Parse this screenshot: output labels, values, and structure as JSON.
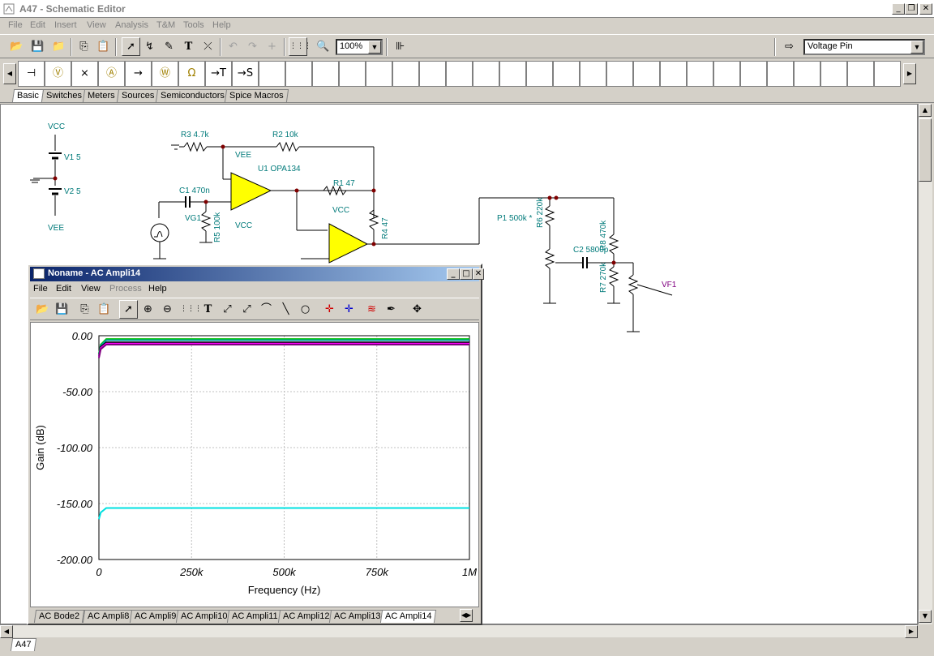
{
  "window": {
    "title": "A47 - Schematic Editor"
  },
  "menu": [
    "File",
    "Edit",
    "Insert",
    "View",
    "Analysis",
    "T&M",
    "Tools",
    "Help"
  ],
  "toolbar": {
    "zoom": "100%",
    "pin_type": "Voltage Pin"
  },
  "component_tabs": [
    "Basic",
    "Switches",
    "Meters",
    "Sources",
    "Semiconductors",
    "Spice Macros"
  ],
  "schematic": {
    "labels": {
      "vcc1": "VCC",
      "v1": "V1 5",
      "v2": "V2 5",
      "vee1": "VEE",
      "r3": "R3 4.7k",
      "r2": "R2 10k",
      "vee2": "VEE",
      "u1": "U1 OPA134",
      "c1": "C1 470n",
      "r1": "R1 47",
      "vg1": "VG1",
      "r5": "R5 100k",
      "vcc2": "VCC",
      "vcc3": "VCC",
      "r4": "R4 47",
      "p1": "P1 500k *",
      "r6": "R6 220k",
      "c2": "C2 5800p",
      "r8": "R8 470k",
      "r7": "R7 270k",
      "vf1": "VF1"
    }
  },
  "bottom_tab": "A47",
  "analysis_window": {
    "title": "Noname - AC Ampli14",
    "menu": [
      "File",
      "Edit",
      "View",
      "Process",
      "Help"
    ],
    "tabs": [
      "AC Bode2",
      "AC Ampli8",
      "AC Ampli9",
      "AC Ampli10",
      "AC Ampli11",
      "AC Ampli12",
      "AC Ampli13",
      "AC Ampli14"
    ],
    "active_tab": "AC Ampli14"
  },
  "chart_data": {
    "type": "line",
    "xlabel": "Frequency (Hz)",
    "ylabel": "Gain (dB)",
    "xlim": [
      0,
      1000000
    ],
    "ylim": [
      -200,
      0
    ],
    "x_ticks": [
      "0",
      "250k",
      "500k",
      "750k",
      "1M"
    ],
    "y_ticks": [
      "0.00",
      "-50.00",
      "-100.00",
      "-150.00",
      "-200.00"
    ],
    "grid": true,
    "series": [
      {
        "color": "#00c000",
        "x": [
          0,
          5000,
          20000,
          1000000
        ],
        "values": [
          -16,
          -8,
          -3,
          -3
        ]
      },
      {
        "color": "#00a0a0",
        "x": [
          0,
          5000,
          20000,
          1000000
        ],
        "values": [
          -17,
          -9,
          -4,
          -4
        ]
      },
      {
        "color": "#000000",
        "x": [
          0,
          5000,
          20000,
          1000000
        ],
        "values": [
          -18,
          -10,
          -6,
          -6
        ]
      },
      {
        "color": "#ff00ff",
        "x": [
          0,
          5000,
          20000,
          1000000
        ],
        "values": [
          -19,
          -11,
          -7,
          -7
        ]
      },
      {
        "color": "#800080",
        "x": [
          0,
          5000,
          20000,
          1000000
        ],
        "values": [
          -20,
          -12,
          -8,
          -8
        ]
      },
      {
        "color": "#00e0e0",
        "x": [
          0,
          5000,
          20000,
          1000000
        ],
        "values": [
          -164,
          -158,
          -154,
          -154
        ]
      }
    ]
  }
}
